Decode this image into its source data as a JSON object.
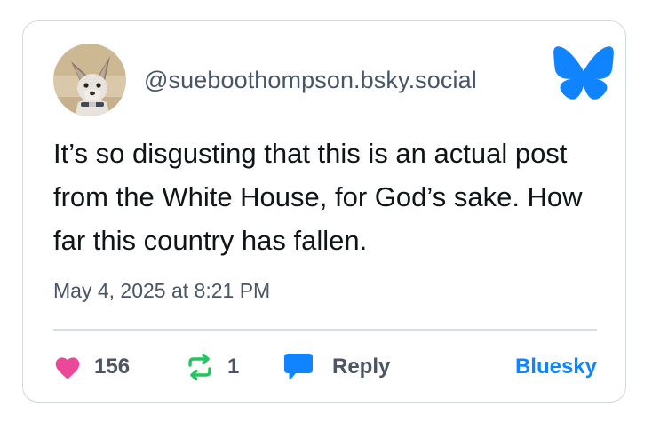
{
  "post": {
    "handle": "@sueboothompson.bsky.social",
    "text": "It’s so disgusting that this is an actual post from the White House, for God’s sake. How far this country has fallen.",
    "timestamp": "May 4, 2025 at 8:21 PM"
  },
  "actions": {
    "likes": "156",
    "reposts": "1",
    "reply_label": "Reply",
    "open_link_label": "Bluesky"
  },
  "icons": {
    "avatar": "avatar-dog-photo",
    "logo": "bluesky-butterfly-icon",
    "like": "heart-icon",
    "repost": "repost-arrows-icon",
    "reply": "speech-bubble-icon"
  },
  "colors": {
    "heart": "#ec4899",
    "repost": "#22c55e",
    "reply_bubble": "#1083fe",
    "brand": "#1083fe",
    "text": "#0f1419",
    "muted": "#4b5563",
    "border": "#cfd9de"
  }
}
